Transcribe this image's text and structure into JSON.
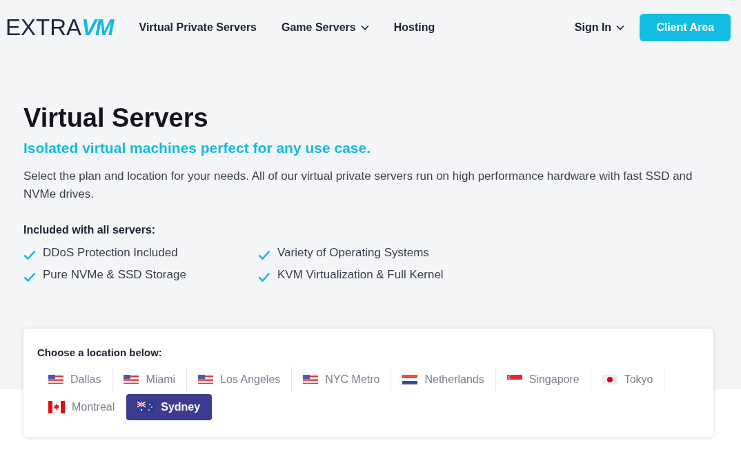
{
  "logo": {
    "text": "EXTRA",
    "accent": "VM"
  },
  "nav": [
    {
      "label": "Virtual Private Servers",
      "dropdown": false
    },
    {
      "label": "Game Servers",
      "dropdown": true
    },
    {
      "label": "Hosting",
      "dropdown": false
    }
  ],
  "sign_in": {
    "label": "Sign In",
    "dropdown": true
  },
  "client_area": "Client Area",
  "hero": {
    "title": "Virtual Servers",
    "subtitle": "Isolated virtual machines perfect for any use case.",
    "description": "Select the plan and location for your needs. All of our virtual private servers run on high performance hardware with fast SSD and NVMe drives.",
    "features_heading": "Included with all servers:",
    "features": [
      "DDoS Protection Included",
      "Variety of Operating Systems",
      "Pure NVMe & SSD Storage",
      "KVM Virtualization & Full Kernel"
    ]
  },
  "locations": {
    "heading": "Choose a location below:",
    "items": [
      {
        "label": "Dallas",
        "kind": "us",
        "selected": false
      },
      {
        "label": "Miami",
        "kind": "us",
        "selected": false
      },
      {
        "label": "Los Angeles",
        "kind": "us",
        "selected": false
      },
      {
        "label": "NYC Metro",
        "kind": "us",
        "selected": false
      },
      {
        "label": "Netherlands",
        "kind": "nl",
        "selected": false
      },
      {
        "label": "Singapore",
        "kind": "sg",
        "selected": false
      },
      {
        "label": "Tokyo",
        "kind": "jp",
        "selected": false
      },
      {
        "label": "Montreal",
        "kind": "ca",
        "selected": false
      },
      {
        "label": "Sydney",
        "kind": "au",
        "selected": true
      }
    ]
  }
}
